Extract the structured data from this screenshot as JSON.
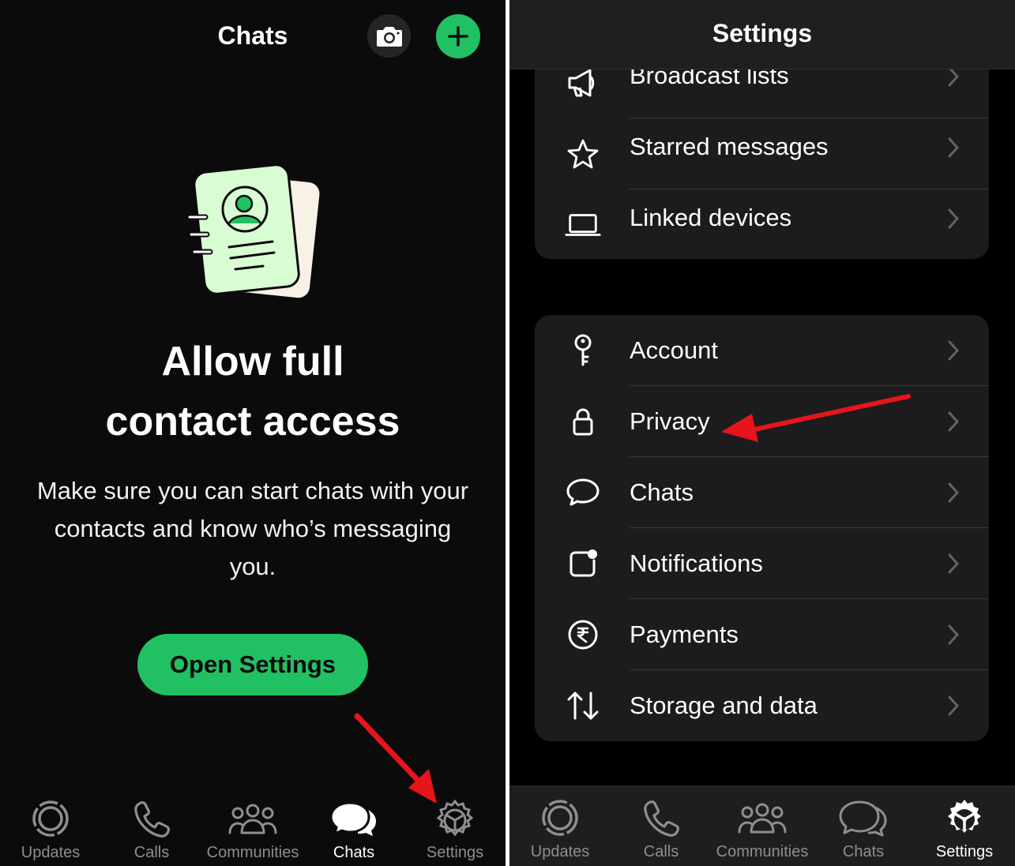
{
  "left": {
    "header": {
      "title": "Chats"
    },
    "prompt": {
      "headline_line1": "Allow full",
      "headline_line2": "contact access",
      "description": "Make sure you can start chats with your contacts and know who’s messaging you.",
      "button_label": "Open Settings"
    },
    "tabs": [
      {
        "label": "Updates",
        "icon": "updates-icon",
        "active": false
      },
      {
        "label": "Calls",
        "icon": "phone-icon",
        "active": false
      },
      {
        "label": "Communities",
        "icon": "communities-icon",
        "active": false
      },
      {
        "label": "Chats",
        "icon": "chat-bubbles-icon",
        "active": true
      },
      {
        "label": "Settings",
        "icon": "gear-icon",
        "active": false
      }
    ]
  },
  "right": {
    "header": {
      "title": "Settings"
    },
    "group1": [
      {
        "label": "Broadcast lists",
        "icon": "megaphone-icon"
      },
      {
        "label": "Starred messages",
        "icon": "star-icon"
      },
      {
        "label": "Linked devices",
        "icon": "laptop-icon"
      }
    ],
    "group2": [
      {
        "label": "Account",
        "icon": "key-icon"
      },
      {
        "label": "Privacy",
        "icon": "lock-icon"
      },
      {
        "label": "Chats",
        "icon": "chat-bubble-icon"
      },
      {
        "label": "Notifications",
        "icon": "notification-icon"
      },
      {
        "label": "Payments",
        "icon": "rupee-icon"
      },
      {
        "label": "Storage and data",
        "icon": "arrows-up-down-icon"
      }
    ],
    "tabs": [
      {
        "label": "Updates",
        "icon": "updates-icon",
        "active": false
      },
      {
        "label": "Calls",
        "icon": "phone-icon",
        "active": false
      },
      {
        "label": "Communities",
        "icon": "communities-icon",
        "active": false
      },
      {
        "label": "Chats",
        "icon": "chat-bubbles-icon",
        "active": false
      },
      {
        "label": "Settings",
        "icon": "gear-icon",
        "active": true
      }
    ]
  },
  "colors": {
    "accent_green": "#21c063",
    "annotation_red": "#e8141c"
  }
}
